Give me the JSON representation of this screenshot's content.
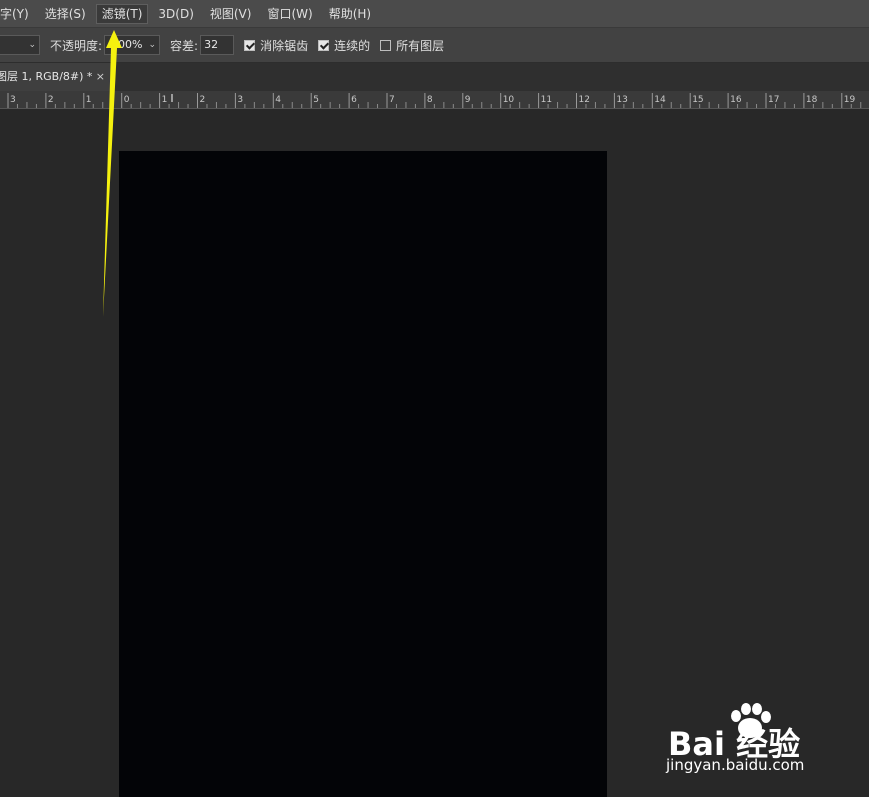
{
  "menu": {
    "items": [
      {
        "label": "字(Y)"
      },
      {
        "label": "选择(S)"
      },
      {
        "label": "滤镜(T)"
      },
      {
        "label": "3D(D)"
      },
      {
        "label": "视图(V)"
      },
      {
        "label": "窗口(W)"
      },
      {
        "label": "帮助(H)"
      }
    ]
  },
  "options": {
    "opacity_label": "不透明度:",
    "opacity_value": "100%",
    "tolerance_label": "容差:",
    "tolerance_value": "32",
    "antialias_label": "消除锯齿",
    "antialias_checked": true,
    "contiguous_label": "连续的",
    "contiguous_checked": true,
    "all_layers_label": "所有图层",
    "all_layers_checked": false
  },
  "document": {
    "tab_title": "图层 1, RGB/8#) *",
    "close_glyph": "×"
  },
  "ruler": {
    "labels": [
      "3",
      "2",
      "1",
      "0",
      "1",
      "2",
      "3",
      "4",
      "5",
      "6",
      "7",
      "8",
      "9",
      "10",
      "11",
      "12",
      "13",
      "14",
      "15",
      "16",
      "17",
      "18",
      "19"
    ]
  },
  "watermark": {
    "brand": "Bai 经验",
    "url": "jingyan.baidu.com"
  },
  "colors": {
    "menubar": "#4b4b4b",
    "optbar": "#424242",
    "workspace": "#282828",
    "canvas": "#030407",
    "arrow": "#f5f10f"
  }
}
